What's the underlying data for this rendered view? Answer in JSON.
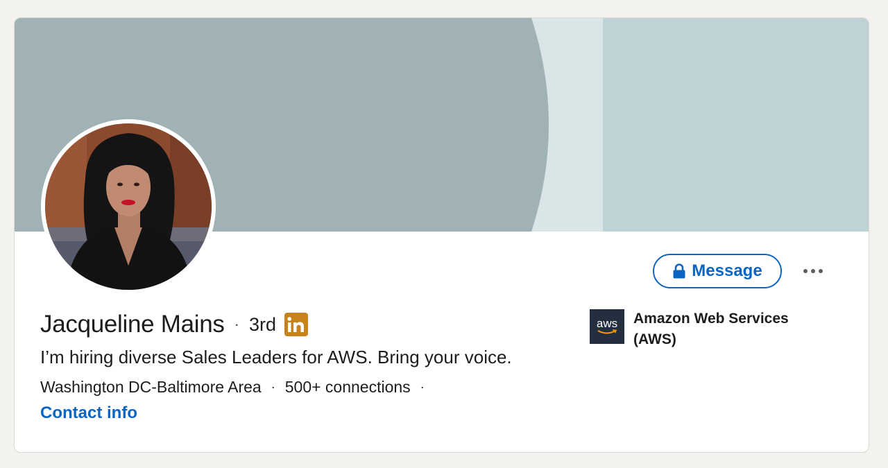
{
  "profile": {
    "name": "Jacqueline Mains",
    "separator": "·",
    "degree": "3rd",
    "headline": "I’m hiring diverse Sales Leaders for AWS. Bring your voice.",
    "location": "Washington DC-Baltimore Area",
    "connections": "500+ connections",
    "meta_separator": "·",
    "contact_info_label": "Contact info"
  },
  "actions": {
    "message_label": "Message"
  },
  "company": {
    "name": "Amazon Web Services (AWS)",
    "logo_text": "aws"
  },
  "icons": {
    "badge": "linkedin-icon",
    "lock": "lock-icon",
    "more": "more-horizontal-icon"
  },
  "colors": {
    "accent": "#0a66c2",
    "badge": "#c8821b",
    "cover_dark": "#a0b2b5",
    "cover_light": "#bfd3d7",
    "cover_stripe": "#d9e5e7",
    "aws_bg": "#232f3e",
    "aws_smile": "#ff9900"
  }
}
